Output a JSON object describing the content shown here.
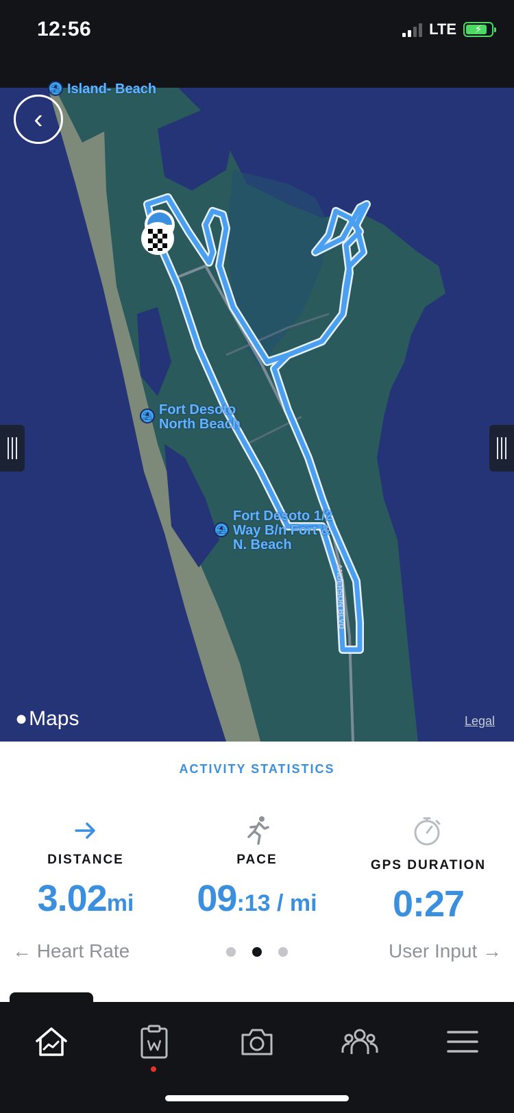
{
  "status_bar": {
    "time": "12:56",
    "network": "LTE"
  },
  "map": {
    "labels": {
      "top_label": "Island- Beach",
      "north_beach_line1": "Fort Desoto",
      "north_beach_line2": "North Beach",
      "half_way_line1": "Fort Desoto 1/2",
      "half_way_line2": "Way B/n Fort &",
      "half_way_line3": "N. Beach",
      "road": "ANDERSON BLVD"
    },
    "attribution": "Maps",
    "legal": "Legal",
    "colors": {
      "water": "#243476",
      "land": "#2a5a5c",
      "sand": "#7d8a7a",
      "route": "#4a9ff0"
    }
  },
  "stats": {
    "title": "ACTIVITY STATISTICS",
    "distance": {
      "label": "DISTANCE",
      "value": "3.02",
      "unit": "mi",
      "icon": "arrow-right-icon"
    },
    "pace": {
      "label": "PACE",
      "value": "09",
      "unit": ":13 / mi",
      "icon": "runner-icon"
    },
    "duration": {
      "label": "GPS DURATION",
      "value": "0:27",
      "icon": "stopwatch-icon"
    },
    "prev": "← Heart Rate",
    "next": "User Input →",
    "page_count": 3,
    "active_page": 2
  },
  "nav": {
    "items": [
      "home-icon",
      "clipboard-icon",
      "camera-icon",
      "community-icon",
      "menu-icon"
    ]
  }
}
